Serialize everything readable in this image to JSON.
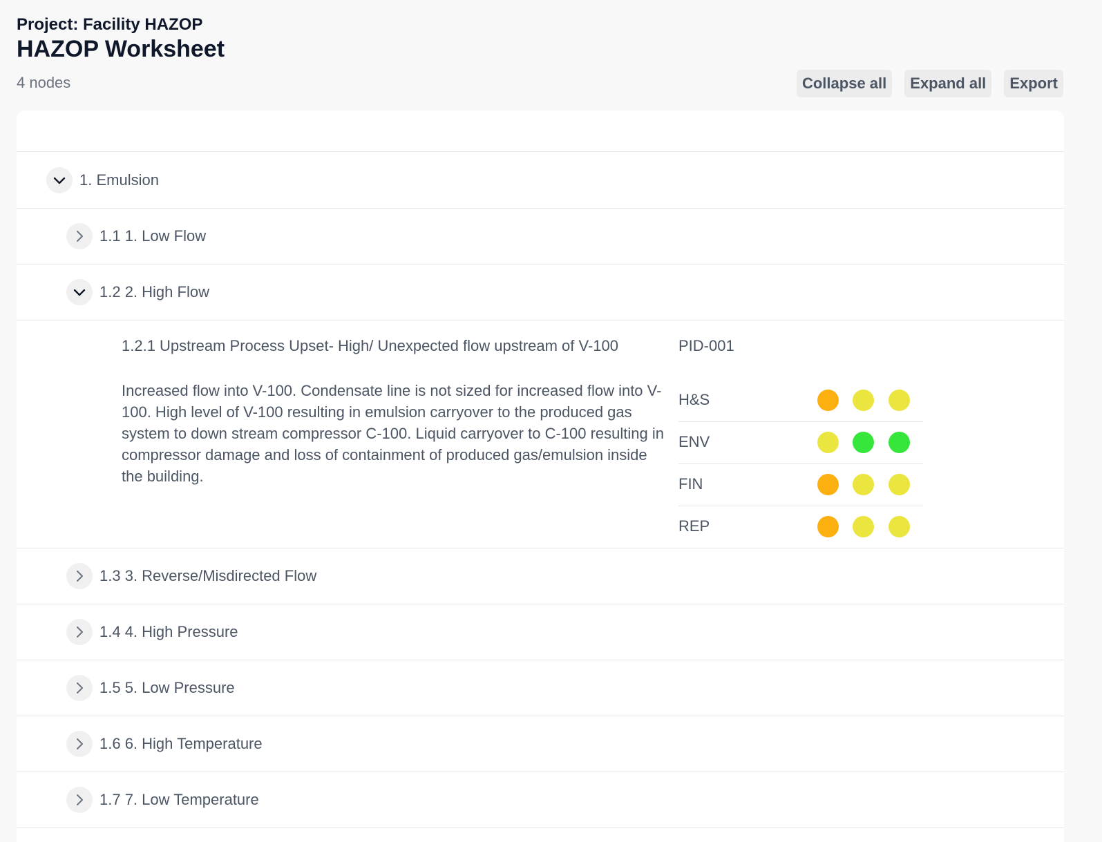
{
  "header": {
    "project": "Project: Facility HAZOP",
    "title": "HAZOP Worksheet",
    "node_count": "4 nodes"
  },
  "toolbar": {
    "collapse_all": "Collapse all",
    "expand_all": "Expand all",
    "export": "Export"
  },
  "tree": {
    "node": {
      "label": "1. Emulsion",
      "expanded": true
    },
    "deviations": [
      {
        "label": "1.1 1. Low Flow",
        "expanded": false
      },
      {
        "label": "1.2 2. High Flow",
        "expanded": true
      },
      {
        "label": "1.3 3. Reverse/Misdirected Flow",
        "expanded": false
      },
      {
        "label": "1.4 4. High Pressure",
        "expanded": false
      },
      {
        "label": "1.5 5. Low Pressure",
        "expanded": false
      },
      {
        "label": "1.6 6. High Temperature",
        "expanded": false
      },
      {
        "label": "1.7 7. Low Temperature",
        "expanded": false
      }
    ]
  },
  "cause": {
    "title": "1.2.1 Upstream Process Upset- High/ Unexpected flow upstream of V-100",
    "pid": "PID-001",
    "consequence": "Increased flow into V-100. Condensate line is not sized for increased flow into V-100. High level of V-100 resulting in emulsion carryover to the produced gas system to down stream compressor C-100. Liquid carryover to C-100 resulting in compressor damage and loss of containment of produced gas/emulsion inside the building.",
    "risks": [
      {
        "category": "H&S",
        "dots": [
          "#fbb00f",
          "#ebe53f",
          "#ebe53f"
        ]
      },
      {
        "category": "ENV",
        "dots": [
          "#ebe53f",
          "#37e63a",
          "#37e63a"
        ]
      },
      {
        "category": "FIN",
        "dots": [
          "#fbb00f",
          "#ebe53f",
          "#ebe53f"
        ]
      },
      {
        "category": "REP",
        "dots": [
          "#fbb00f",
          "#ebe53f",
          "#ebe53f"
        ]
      }
    ]
  }
}
